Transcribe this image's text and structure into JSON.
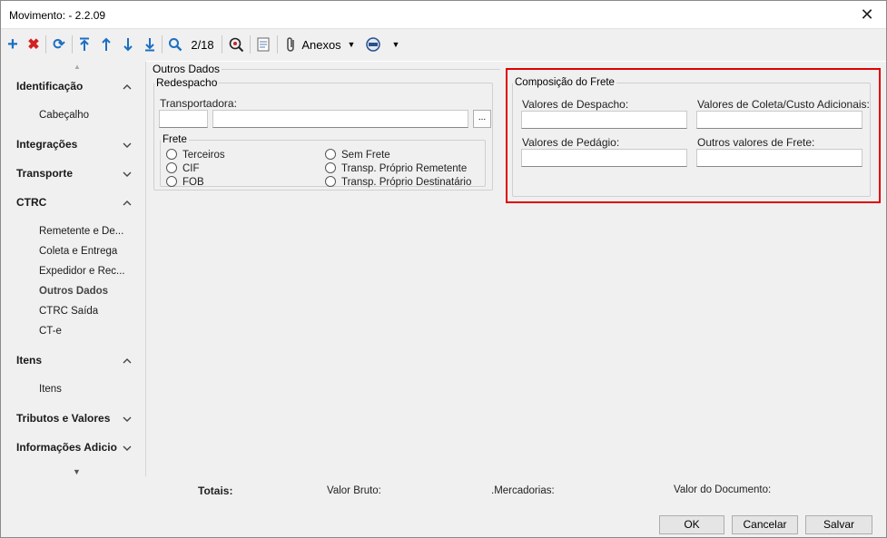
{
  "window": {
    "title": "Movimento:  - 2.2.09",
    "close_glyph": "✕"
  },
  "toolbar": {
    "page_indicator": "2/18",
    "attachments_label": "Anexos"
  },
  "sidebar": {
    "sections": [
      {
        "label": "Identificação",
        "expanded": true,
        "items": [
          "Cabeçalho"
        ]
      },
      {
        "label": "Integrações",
        "expanded": false,
        "items": []
      },
      {
        "label": "Transporte",
        "expanded": false,
        "items": []
      },
      {
        "label": "CTRC",
        "expanded": true,
        "items": [
          "Remetente e De...",
          "Coleta e Entrega",
          "Expedidor e Rec...",
          "Outros Dados",
          "CTRC Saída",
          "CT-e"
        ]
      },
      {
        "label": "Itens",
        "expanded": true,
        "items": [
          "Itens"
        ]
      },
      {
        "label": "Tributos e Valores",
        "expanded": false,
        "items": []
      },
      {
        "label": "Informações Adicio",
        "expanded": false,
        "items": []
      }
    ],
    "active_item": "Outros Dados"
  },
  "main": {
    "group_title": "Outros Dados",
    "redespacho": {
      "title": "Redespacho",
      "transportadora_label": "Transportadora:",
      "code_value": "",
      "name_value": "",
      "lookup_label": "..."
    },
    "frete": {
      "title": "Frete",
      "options": [
        "Terceiros",
        "CIF",
        "FOB",
        "Sem Frete",
        "Transp. Próprio Remetente",
        "Transp. Próprio Destinatário"
      ]
    },
    "composicao": {
      "title": "Composição do Frete",
      "fields": [
        {
          "label": "Valores de Despacho:",
          "value": ""
        },
        {
          "label": "Valores de Coleta/Custo Adicionais:",
          "value": ""
        },
        {
          "label": "Valores de Pedágio:",
          "value": ""
        },
        {
          "label": "Outros valores de Frete:",
          "value": ""
        }
      ],
      "highlight_color": "#e00000"
    }
  },
  "totals": {
    "label": "Totais:",
    "valor_bruto": "Valor Bruto:",
    "mercadorias": ".Mercadorias:",
    "valor_documento": "Valor do Documento:"
  },
  "buttons": {
    "ok": "OK",
    "cancel": "Cancelar",
    "save": "Salvar"
  }
}
